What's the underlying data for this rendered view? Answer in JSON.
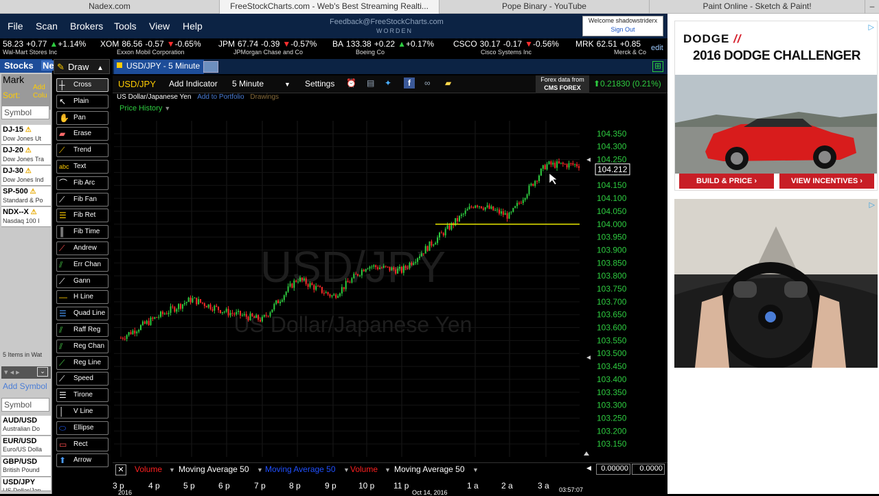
{
  "browser_tabs": [
    "Nadex.com",
    "FreeStockCharts.com - Web's Best Streaming Realti...",
    "Pope Binary - YouTube",
    "Paint Online - Sketch & Paint!"
  ],
  "menu": [
    "File",
    "Scan",
    "Brokers",
    "Tools",
    "View",
    "Help"
  ],
  "feedback": "Feedback@FreeStockCharts.com",
  "brand": "WORDEN",
  "welcome": {
    "text": "Welcome shadowstriderx",
    "signout": "Sign Out"
  },
  "ticker": [
    {
      "sym": "",
      "price": "58.23",
      "chg": "+0.77",
      "dir": "up",
      "pct": "+1.14%",
      "name": "Wal-Mart Stores Inc"
    },
    {
      "sym": "XOM",
      "price": "86.56",
      "chg": "-0.57",
      "dir": "dn",
      "pct": "-0.65%",
      "name": "Exxon Mobil Corporation"
    },
    {
      "sym": "JPM",
      "price": "67.74",
      "chg": "-0.39",
      "dir": "dn",
      "pct": "-0.57%",
      "name": "JPMorgan Chase and Co"
    },
    {
      "sym": "BA",
      "price": "133.38",
      "chg": "+0.22",
      "dir": "up",
      "pct": "+0.17%",
      "name": "Boeing Co"
    },
    {
      "sym": "CSCO",
      "price": "30.17",
      "chg": "-0.17",
      "dir": "dn",
      "pct": "-0.56%",
      "name": "Cisco Systems Inc"
    },
    {
      "sym": "MRK",
      "price": "62.51",
      "chg": "+0.85",
      "dir": "",
      "pct": "",
      "name": "Merck & Co"
    }
  ],
  "edit_label": "edit",
  "sidebar": {
    "tab1": "Stocks",
    "tab2": "Ne",
    "mark": "Mark",
    "sort": "Sort:",
    "add": "Add",
    "colu": "Colu",
    "symbol_ph": "Symbol",
    "indices": [
      {
        "sym": "DJ-15",
        "name": "Dow Jones Ut"
      },
      {
        "sym": "DJ-20",
        "name": "Dow Jones Tra"
      },
      {
        "sym": "DJ-30",
        "name": "Dow Jones Ind"
      },
      {
        "sym": "SP-500",
        "name": "Standard & Po"
      },
      {
        "sym": "NDX--X",
        "name": "Nasdaq 100 I"
      }
    ],
    "items_count": "5 Items in Wat",
    "add_symbol": "Add Symbol",
    "forex": [
      {
        "sym": "AUD/USD",
        "name": "Australian Do"
      },
      {
        "sym": "EUR/USD",
        "name": "Euro/US Dolla"
      },
      {
        "sym": "GBP/USD",
        "name": "British Pound"
      },
      {
        "sym": "USD/JPY",
        "name": "US Dollar/Jap"
      }
    ]
  },
  "toolbox": {
    "header": "Draw",
    "tools": [
      "Cross",
      "Plain",
      "Pan",
      "Erase",
      "Trend",
      "Text",
      "Fib Arc",
      "Fib Fan",
      "Fib Ret",
      "Fib Time",
      "Andrew",
      "Err Chan",
      "Gann",
      "H Line",
      "Quad Line",
      "Raff Reg",
      "Reg Chan",
      "Reg Line",
      "Speed",
      "Tirone",
      "V Line",
      "Ellipse",
      "Rect",
      "Arrow"
    ]
  },
  "chart": {
    "tab": "USD/JPY - 5 Minute",
    "symbol": "USD/JPY",
    "add_indicator": "Add Indicator",
    "interval": "5 Minute",
    "settings": "Settings",
    "forex_data_from": "Forex data from",
    "forex_provider": "CMS FOREX",
    "quote": "0.21830 (0.21%)",
    "full_name": "US Dollar/Japanese Yen",
    "add_to_portfolio": "Add to Portfolio",
    "drawings": "Drawings",
    "price_history": "Price History",
    "watermark1": "USD/JPY",
    "watermark2": "US Dollar/Japanese Yen",
    "current_price": "104.212",
    "indicators": [
      {
        "label": "Volume",
        "color": "#ff2020"
      },
      {
        "label": "Moving Average 50",
        "color": "#ffffff"
      },
      {
        "label": "Moving Average 50",
        "color": "#2050ff"
      },
      {
        "label": "Volume",
        "color": "#ff2020"
      },
      {
        "label": "Moving Average 50",
        "color": "#ffffff"
      }
    ],
    "lower_values": [
      "0.00000",
      "0.0000"
    ],
    "time_labels": [
      "3 p",
      "4 p",
      "5 p",
      "6 p",
      "7 p",
      "8 p",
      "9 p",
      "10 p",
      "11 p",
      "1 a",
      "2 a",
      "3 a"
    ],
    "date_labels": [
      "2016",
      "Oct 14, 2016"
    ],
    "clock": "03:57:07"
  },
  "chart_data": {
    "type": "candlestick",
    "title": "USD/JPY - 5 Minute",
    "ylim": [
      103.1,
      104.4
    ],
    "y_ticks": [
      104.35,
      104.3,
      104.25,
      104.2,
      104.15,
      104.1,
      104.05,
      104.0,
      103.95,
      103.9,
      103.85,
      103.8,
      103.75,
      103.7,
      103.65,
      103.6,
      103.55,
      103.5,
      103.45,
      103.4,
      103.35,
      103.3,
      103.25,
      103.2,
      103.15
    ],
    "hline": 104.0,
    "close_path": [
      [
        "3 p",
        103.56
      ],
      [
        "4 p",
        103.64
      ],
      [
        "5 p",
        103.71
      ],
      [
        "6 p",
        103.66
      ],
      [
        "7 p",
        103.63
      ],
      [
        "8 p",
        103.79
      ],
      [
        "9 p",
        103.72
      ],
      [
        "10 p",
        103.84
      ],
      [
        "11 p",
        103.82
      ],
      [
        "1 a",
        104.08
      ],
      [
        "2 a",
        104.03
      ],
      [
        "3 a",
        104.23
      ]
    ]
  },
  "ads": {
    "ad1_brand": "DODGE",
    "ad1_title": "2016 DODGE CHALLENGER",
    "ad1_btn1": "BUILD & PRICE ›",
    "ad1_btn2": "VIEW INCENTIVES ›"
  }
}
